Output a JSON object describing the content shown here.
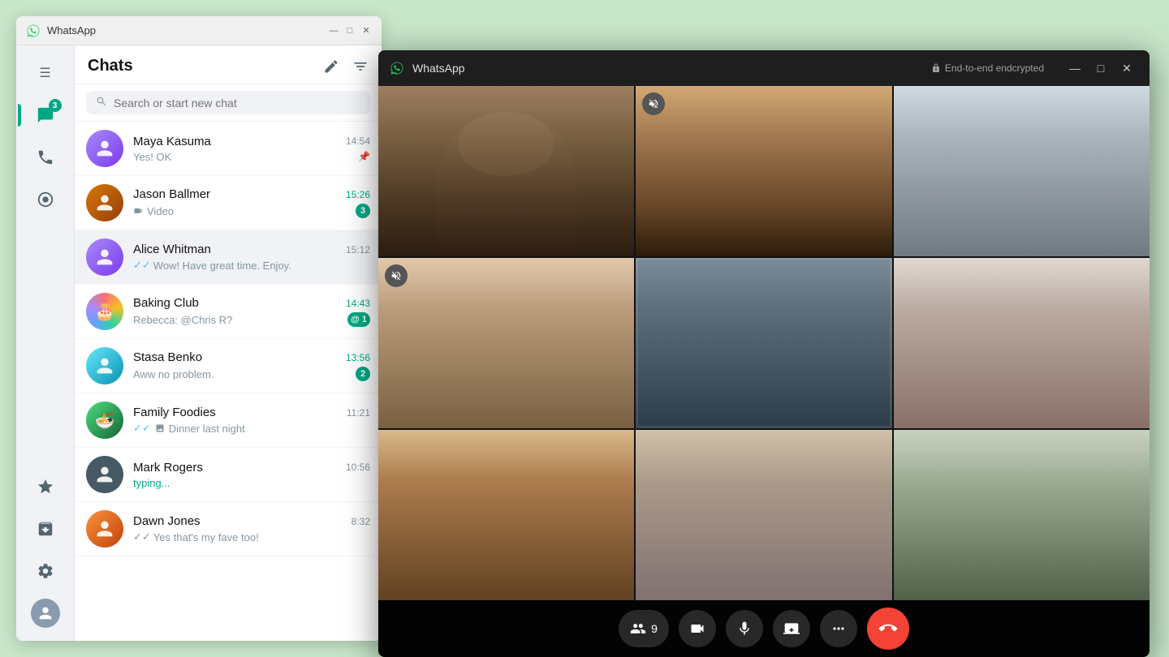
{
  "mainWindow": {
    "title": "WhatsApp",
    "titleBarBtns": [
      "—",
      "□",
      "✕"
    ]
  },
  "sidebar": {
    "items": [
      {
        "name": "menu",
        "icon": "☰",
        "active": false
      },
      {
        "name": "chats",
        "icon": "💬",
        "active": true,
        "badge": "3"
      },
      {
        "name": "calls",
        "icon": "📞",
        "active": false
      },
      {
        "name": "status",
        "icon": "◎",
        "active": false
      },
      {
        "name": "starred",
        "icon": "★",
        "active": false
      },
      {
        "name": "archived",
        "icon": "🗄",
        "active": false
      },
      {
        "name": "settings",
        "icon": "⚙",
        "active": false
      }
    ]
  },
  "chatPanel": {
    "title": "Chats",
    "newChatIcon": "✏",
    "filterIcon": "≡",
    "searchPlaceholder": "Search or start new chat",
    "chats": [
      {
        "id": "maya",
        "name": "Maya Kasuma",
        "time": "14:54",
        "preview": "Yes! OK",
        "pinned": true,
        "unread": 0,
        "avatarClass": "av-maya",
        "avatarEmoji": "👩"
      },
      {
        "id": "jason",
        "name": "Jason Ballmer",
        "time": "15:26",
        "preview": "🎬 Video",
        "unread": 3,
        "unreadColor": "unread",
        "avatarClass": "av-jason",
        "avatarEmoji": "👫"
      },
      {
        "id": "alice",
        "name": "Alice Whitman",
        "time": "15:12",
        "preview": "Wow! Have great time. Enjoy.",
        "unread": 0,
        "active": true,
        "avatarClass": "av-alice",
        "avatarEmoji": "👩",
        "doubleCheck": true
      },
      {
        "id": "baking",
        "name": "Baking Club",
        "time": "14:43",
        "preview": "Rebecca: @Chris R?",
        "unread": 1,
        "mention": true,
        "avatarClass": "av-baking",
        "avatarEmoji": "🎂"
      },
      {
        "id": "stasa",
        "name": "Stasa Benko",
        "time": "13:56",
        "preview": "Aww no problem.",
        "unread": 2,
        "avatarClass": "av-stasa",
        "avatarEmoji": "👩"
      },
      {
        "id": "family",
        "name": "Family Foodies",
        "time": "11:21",
        "preview": "Dinner last night",
        "unread": 0,
        "avatarClass": "av-family",
        "avatarEmoji": "🍜",
        "doubleCheck": true,
        "hasImage": true
      },
      {
        "id": "mark",
        "name": "Mark Rogers",
        "time": "10:56",
        "preview": "typing...",
        "typing": true,
        "unread": 0,
        "avatarClass": "av-mark",
        "avatarEmoji": "👨"
      },
      {
        "id": "dawn",
        "name": "Dawn Jones",
        "time": "8:32",
        "preview": "Yes that's my fave too!",
        "unread": 0,
        "avatarClass": "av-dawn",
        "avatarEmoji": "👨",
        "doubleCheck": true
      }
    ]
  },
  "videoWindow": {
    "title": "WhatsApp",
    "encryptedLabel": "End-to-end endcrypted",
    "participantCount": "9",
    "controls": {
      "participants": "9",
      "video": "📹",
      "mic": "🎤",
      "screen": "📤",
      "more": "•••",
      "endCall": "📞"
    },
    "cells": [
      {
        "id": 1,
        "muted": false,
        "highlighted": false,
        "bgClass": "vc1"
      },
      {
        "id": 2,
        "muted": true,
        "highlighted": false,
        "bgClass": "vc2"
      },
      {
        "id": 3,
        "muted": false,
        "highlighted": false,
        "bgClass": "vc3"
      },
      {
        "id": 4,
        "muted": true,
        "highlighted": false,
        "bgClass": "vc4"
      },
      {
        "id": 5,
        "muted": false,
        "highlighted": true,
        "bgClass": "vc5"
      },
      {
        "id": 6,
        "muted": false,
        "highlighted": false,
        "bgClass": "vc6"
      },
      {
        "id": 7,
        "muted": false,
        "highlighted": false,
        "bgClass": "vc7"
      },
      {
        "id": 8,
        "muted": false,
        "highlighted": false,
        "bgClass": "vc8"
      },
      {
        "id": 9,
        "muted": false,
        "highlighted": false,
        "bgClass": "vc9"
      }
    ]
  }
}
